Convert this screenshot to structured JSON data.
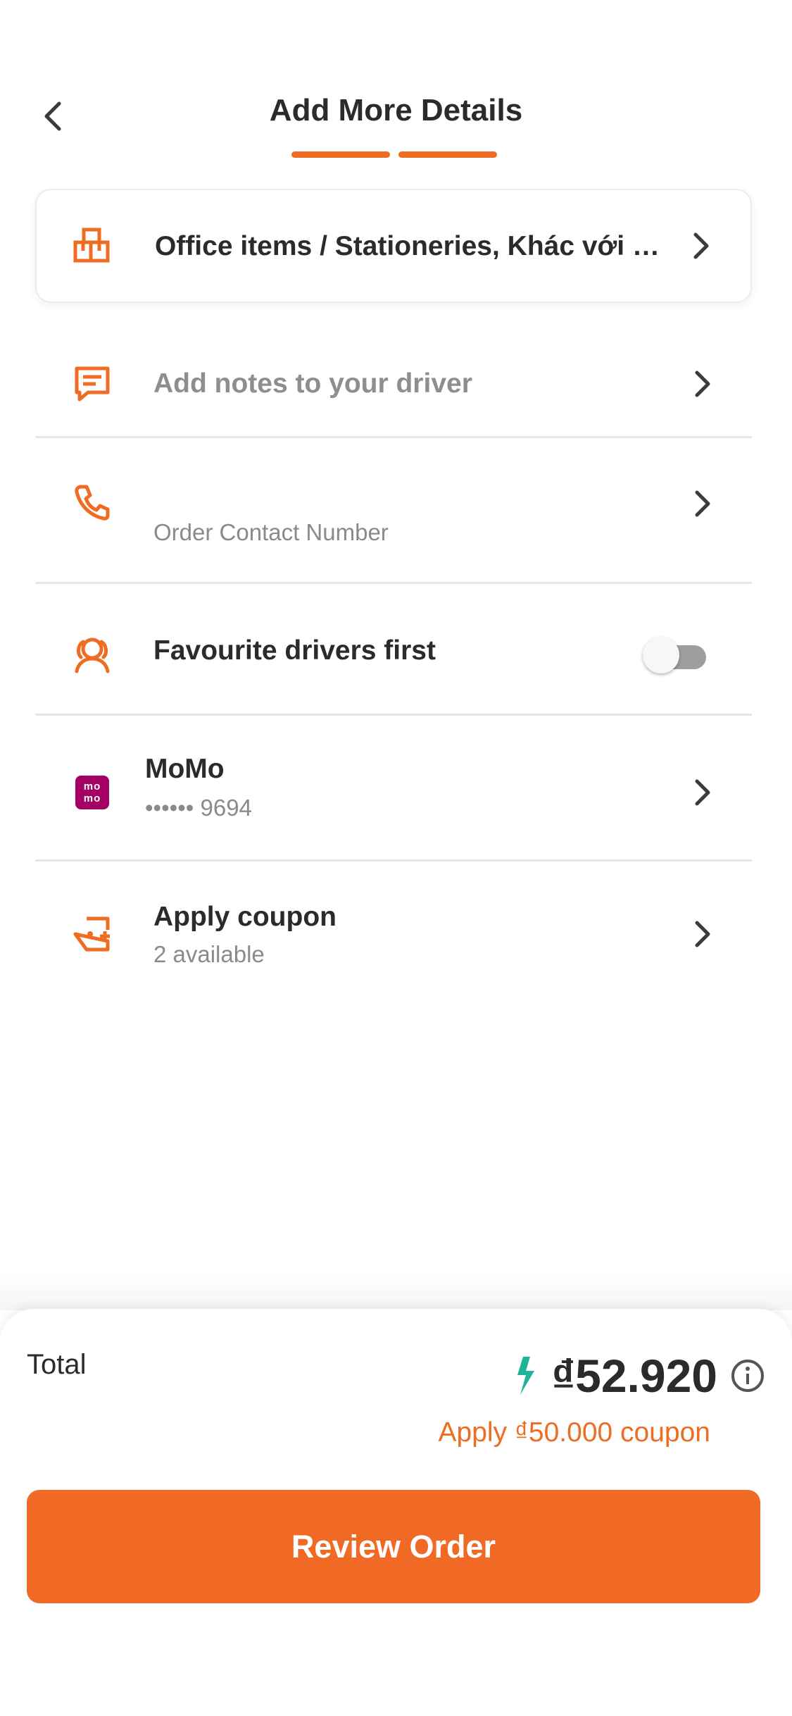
{
  "header": {
    "title": "Add More Details",
    "back_icon": "chevron-left-icon",
    "progress_steps": 2,
    "progress_completed": 2
  },
  "rows": {
    "item_type": {
      "icon": "boxes-icon",
      "label": "Office items / Stationeries, Khác với d..."
    },
    "notes": {
      "icon": "chat-note-icon",
      "placeholder": "Add notes to your driver"
    },
    "contact": {
      "icon": "phone-icon",
      "placeholder": "Order Contact Number"
    },
    "favourite": {
      "icon": "drivers-icon",
      "label": "Favourite drivers first",
      "enabled": false
    },
    "payment": {
      "icon": "momo-logo",
      "logo_text_top": "mo",
      "logo_text_bottom": "mo",
      "label": "MoMo",
      "sub": "•••••• 9694"
    },
    "coupon": {
      "icon": "coupon-tag-icon",
      "label": "Apply coupon",
      "sub": "2 available"
    }
  },
  "footer": {
    "total_label": "Total",
    "total_amount": "₫52.920",
    "coupon_prompt": "Apply ₫50.000 coupon",
    "review_button": "Review Order"
  },
  "colors": {
    "accent": "#ef6c23",
    "momo": "#a50064",
    "lightning": "#1fb39a"
  }
}
